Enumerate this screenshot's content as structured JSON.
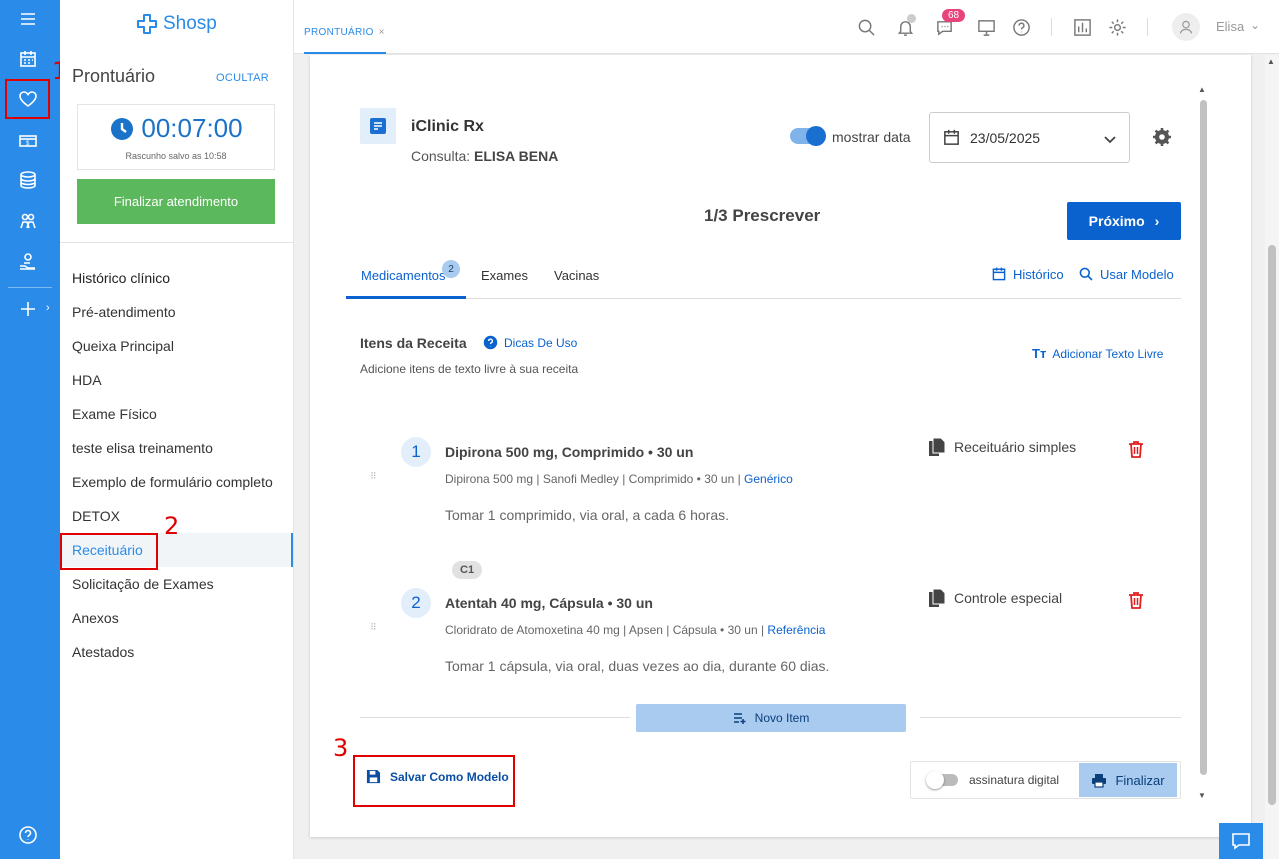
{
  "app": {
    "logo_text": "Shosp"
  },
  "annotations": {
    "n1": "1",
    "n2": "2",
    "n3": "3"
  },
  "sidebar": {
    "title": "Prontuário",
    "hide_label": "OCULTAR",
    "timer": "00:07:00",
    "draft_note": "Rascunho salvo as 10:58",
    "finish_button": "Finalizar atendimento",
    "menu": [
      "Histórico clínico",
      "Pré-atendimento",
      "Queixa Principal",
      "HDA",
      "Exame Físico",
      "teste elisa treinamento",
      "Exemplo de formulário completo",
      "DETOX",
      "Receituário",
      "Solicitação de Exames",
      "Anexos",
      "Atestados"
    ]
  },
  "topbar": {
    "tab_label": "PRONTUÁRIO",
    "tab_close": "×",
    "messages_badge": "68",
    "user_name": "Elisa"
  },
  "rx": {
    "title": "iClinic Rx",
    "consult_prefix": "Consulta:",
    "patient": "ELISA BENA",
    "show_date_label": "mostrar data",
    "date_value": "23/05/2025",
    "step_label": "1/3 Prescrever",
    "next_button": "Próximo",
    "tabs": [
      "Medicamentos",
      "Exames",
      "Vacinas"
    ],
    "med_tab_badge": "2",
    "history_link": "Histórico",
    "use_model_link": "Usar Modelo",
    "items_title": "Itens da Receita",
    "tips_link": "Dicas De Uso",
    "items_subtitle": "Adicione itens de texto livre à sua receita",
    "add_free_text": "Adicionar Texto Livre",
    "medications": [
      {
        "number": "1",
        "name": "Dipirona 500 mg, Comprimido • 30 un",
        "details": "Dipirona 500 mg | Sanofi Medley | Comprimido • 30 un |",
        "details_link": "Genérico",
        "posology": "Tomar 1 comprimido, via oral, a cada 6 horas.",
        "prescription_type": "Receituário simples"
      },
      {
        "number": "2",
        "name": "Atentah 40 mg, Cápsula • 30 un",
        "details": "Cloridrato de Atomoxetina 40 mg | Apsen | Cápsula • 30 un |",
        "details_link": "Referência",
        "posology": "Tomar 1 cápsula, via oral, duas vezes ao dia, durante 60 dias.",
        "prescription_type": "Controle especial"
      }
    ],
    "control_badge": "C1",
    "new_item_button": "Novo Item",
    "save_model_button": "Salvar Como Modelo",
    "digital_signature_label": "assinatura digital",
    "finalize_button": "Finalizar"
  }
}
